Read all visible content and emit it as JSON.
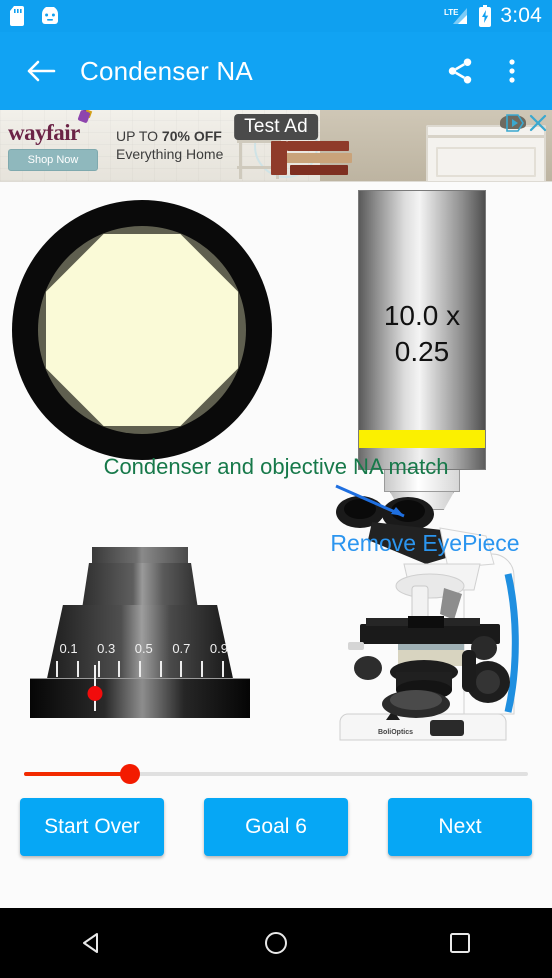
{
  "status_bar": {
    "icons": [
      "sd-card-icon",
      "android-head-icon"
    ],
    "network_label": "LTE",
    "battery_icon": "battery-charging-icon",
    "time": "3:04"
  },
  "app_bar": {
    "back_icon": "back-arrow-icon",
    "title": "Condenser NA",
    "share_icon": "share-icon",
    "overflow_icon": "overflow-menu-icon"
  },
  "ad": {
    "brand": "wayfair",
    "headline_prefix": "UP TO ",
    "headline_bold": "70% OFF",
    "subhead": "Everything Home",
    "cta": "Shop Now",
    "test_label": "Test Ad",
    "adchoices_icon": "adchoices-icon",
    "close_icon": "close-icon"
  },
  "simulation": {
    "diaphragm": {
      "name": "condenser-aperture-view",
      "outer_color": "#0a0a0a",
      "ring_color": "#5f5f4f",
      "aperture_color": "#fafad7",
      "aperture_sides": 8
    },
    "objective": {
      "magnification": "10.0 x",
      "numerical_aperture": "0.25",
      "band_color": "#fbf000"
    },
    "status_message": "Condenser and objective NA match",
    "status_color": "#17794a",
    "condenser": {
      "scale_labels": [
        "0.1",
        "0.3",
        "0.5",
        "0.7",
        "0.9"
      ],
      "scale_label_positions": [
        12,
        32,
        52,
        72,
        92
      ],
      "tick_positions": [
        6,
        17,
        28,
        39,
        50,
        61,
        72,
        83,
        94
      ],
      "indicator_value": 0.25,
      "indicator_position_pct": 26,
      "indicator_color": "#f20c0c"
    },
    "microscope": {
      "label": "Remove EyePiece",
      "label_color": "#2b95ef",
      "arrow_icon": "pointer-arrow-icon"
    },
    "slider": {
      "name": "condenser-aperture-slider",
      "value_pct": 21,
      "track_color": "#e0e0e0",
      "fill_color": "#f22a00",
      "thumb_color": "#f31b00"
    }
  },
  "buttons": {
    "start_over": "Start Over",
    "goal": "Goal 6",
    "next": "Next",
    "color": "#06A7F5"
  },
  "nav_bar": {
    "back": "back-triangle-icon",
    "home": "home-circle-icon",
    "recents": "recents-square-icon"
  }
}
